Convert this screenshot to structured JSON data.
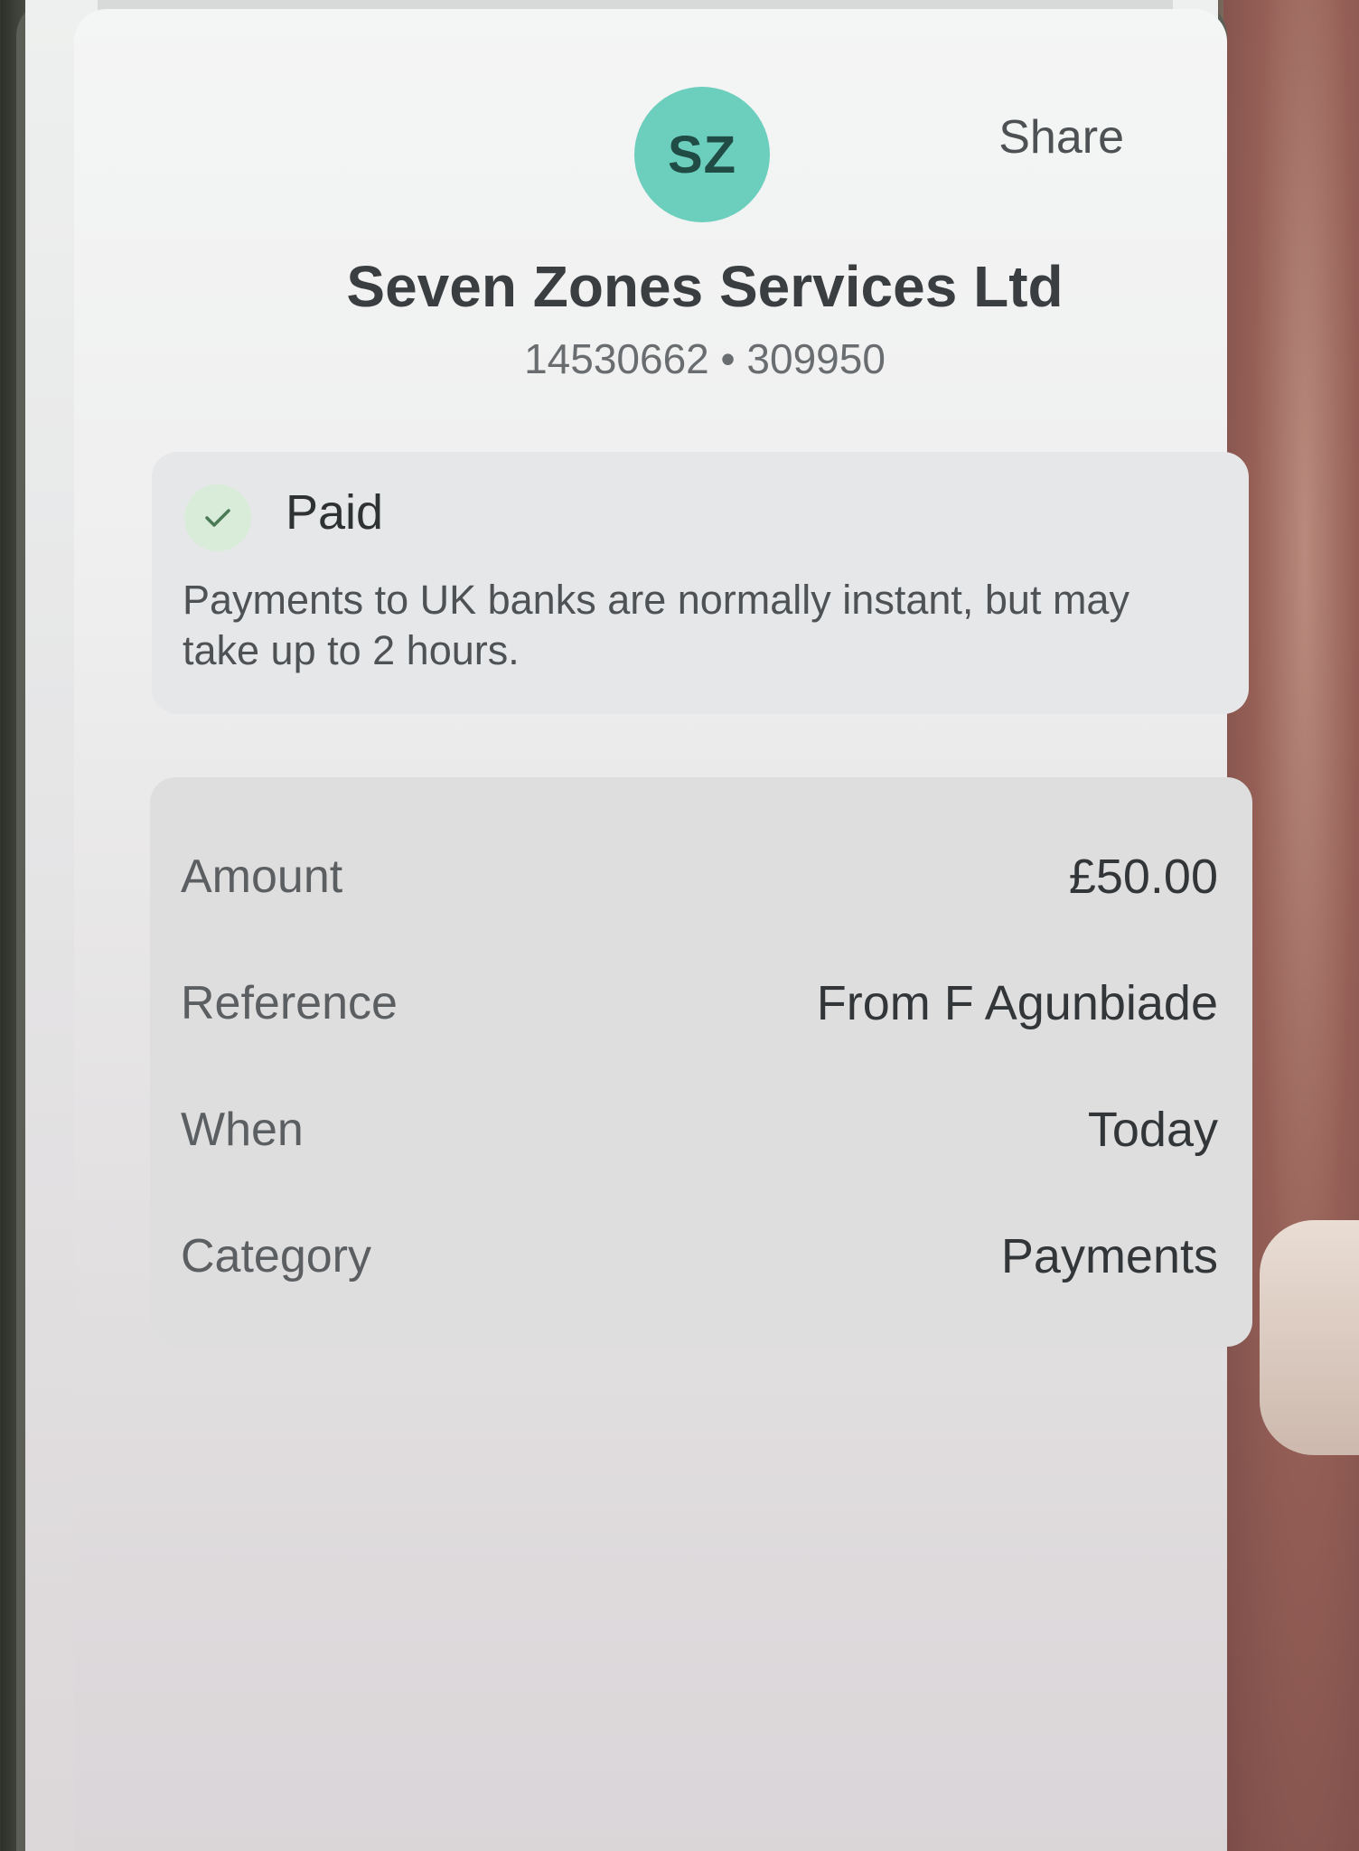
{
  "header": {
    "avatar_initials": "SZ",
    "share_label": "Share"
  },
  "payee": {
    "name": "Seven Zones Services Ltd",
    "account_number": "14530662",
    "separator": "•",
    "sort_code": "309950"
  },
  "status": {
    "label": "Paid",
    "icon": "check-icon",
    "note": "Payments to UK banks are normally instant, but may take up to 2 hours."
  },
  "details": [
    {
      "label": "Amount",
      "value": "£50.00"
    },
    {
      "label": "Reference",
      "value": "From F Agunbiade"
    },
    {
      "label": "When",
      "value": "Today"
    },
    {
      "label": "Category",
      "value": "Payments"
    }
  ],
  "colors": {
    "avatar_bg": "#6ccfbd",
    "avatar_text": "#214b45",
    "check_bg": "#d9ecd9"
  }
}
